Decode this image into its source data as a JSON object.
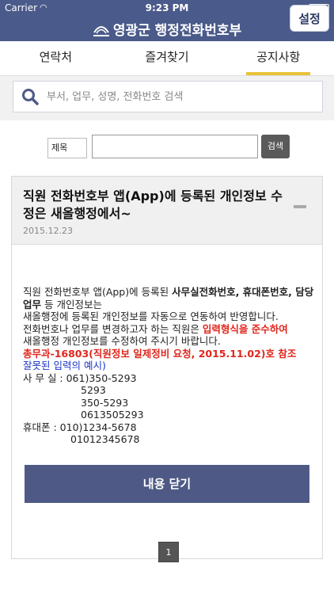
{
  "status_bar": {
    "carrier": "Carrier",
    "time": "9:23 PM"
  },
  "header": {
    "title": "영광군 행정전화번호부",
    "settings_label": "설정"
  },
  "tabs": [
    {
      "label": "연락처"
    },
    {
      "label": "즐겨찾기"
    },
    {
      "label": "공지사항",
      "active": true
    }
  ],
  "search": {
    "placeholder": "부서, 업무, 성명, 전화번호 검색"
  },
  "filter": {
    "label": "제목",
    "value": "",
    "button_label": "검색"
  },
  "notice": {
    "title": "직원 전화번호부 앱(App)에 등록된 개인정보 수정은 새올행정에서~",
    "date": "2015.12.23",
    "body": {
      "p1_a": "직원 전화번호부 앱(App)에 등록된 ",
      "p1_b": "사무실전화번호, 휴대폰번호, 담당업무",
      "p1_c": " 등 개인정보는",
      "p2": "새올행정에 등록된 개인정보를 자동으로 연동하여 반영합니다.",
      "p3_a": "전화번호나 업무를 변경하고자 하는 직원은 ",
      "p3_b": "입력형식을 준수하여",
      "p4": "새올행정 개인정보를 수정하여 주시기 바랍니다.",
      "p5": "총무과-16803(직원정보 일제정비 요청, 2015.11.02)호 참조",
      "p6": "잘못된 입력의 예시)",
      "office_label": "사 무 실 : 061)350-5293",
      "office_ex": [
        "5293",
        "350-5293",
        "0613505293"
      ],
      "mobile_label": "휴대폰 : 010)1234-5678",
      "mobile_ex": [
        "01012345678"
      ]
    },
    "close_label": "내용 닫기"
  },
  "pagination": {
    "current": "1"
  },
  "colors": {
    "header_bg": "#4a5a8a",
    "accent_tab": "#e8c23a",
    "close_btn": "#4e5a85",
    "red_text": "#e0261c",
    "blue_text": "#1a35c8"
  }
}
